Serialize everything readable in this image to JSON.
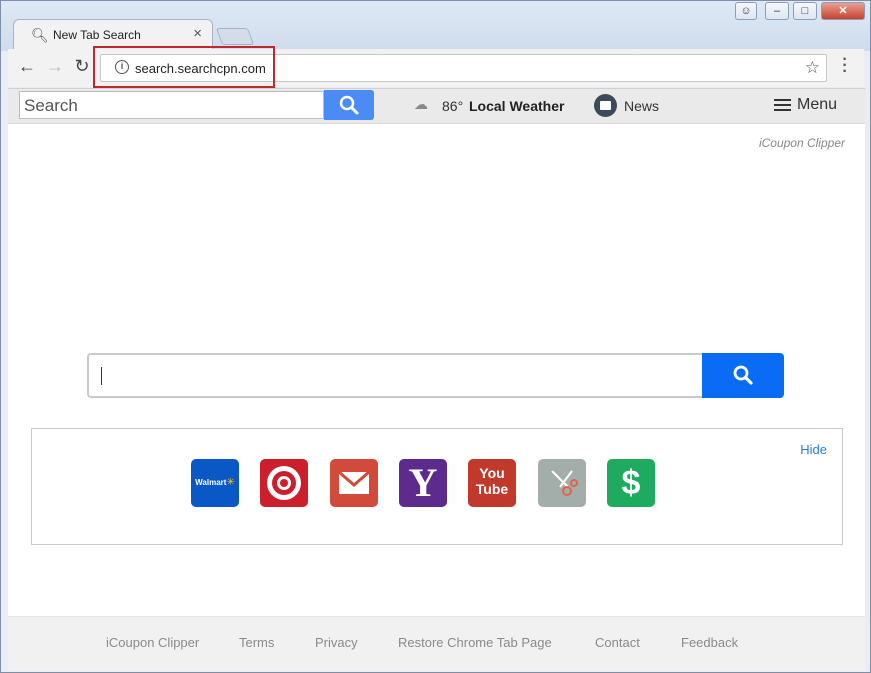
{
  "browser": {
    "tab_title": "New Tab Search",
    "url": "search.searchcpn.com"
  },
  "topbar": {
    "search_placeholder": "Search",
    "weather_temp": "86°",
    "weather_label": "Local Weather",
    "news_label": "News",
    "menu_label": "Menu"
  },
  "brand": "iCoupon Clipper",
  "quicklinks": {
    "hide_label": "Hide",
    "items": [
      {
        "name": "walmart",
        "text": "Walmart",
        "color": "#0a57c6"
      },
      {
        "name": "target",
        "text": "",
        "color": "#cc1f2b"
      },
      {
        "name": "gmail",
        "text": "",
        "color": "#d24a3a"
      },
      {
        "name": "yahoo",
        "text": "Y",
        "color": "#5d2a8e"
      },
      {
        "name": "youtube",
        "text": "You Tube",
        "color": "#c0392b"
      },
      {
        "name": "coupon-clipper",
        "text": "",
        "color": "#a3aeab"
      },
      {
        "name": "dollar",
        "text": "$",
        "color": "#1eab5f"
      }
    ]
  },
  "footer": {
    "links": [
      "iCoupon Clipper",
      "Terms",
      "Privacy",
      "Restore Chrome Tab Page",
      "Contact",
      "Feedback"
    ]
  },
  "colors": {
    "accent": "#0a6cf5",
    "highlight_border": "#c0292b"
  }
}
